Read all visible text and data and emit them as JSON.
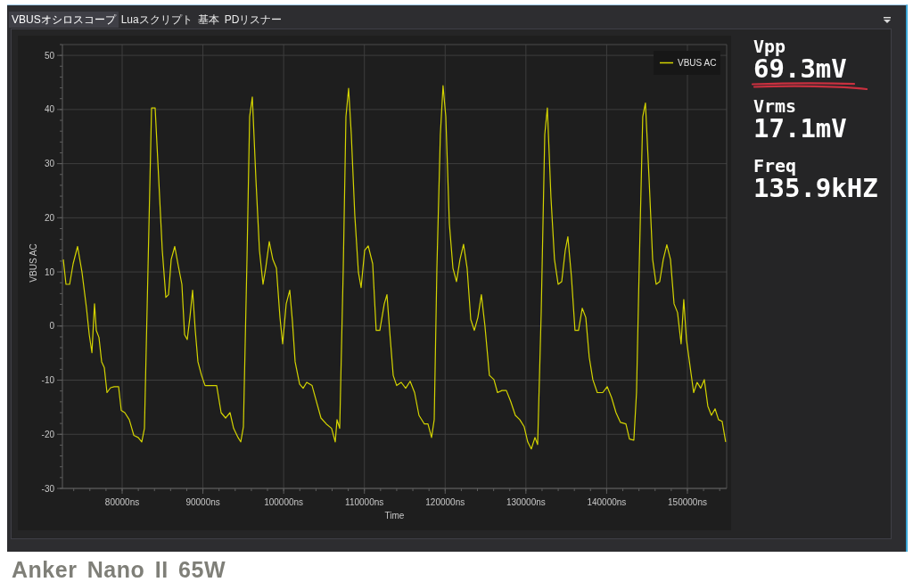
{
  "tabs": [
    {
      "label": "VBUSオシロスコープ",
      "selected": true
    },
    {
      "label": "Luaスクリプト",
      "selected": false
    },
    {
      "label": "基本",
      "selected": false
    },
    {
      "label": "PDリスナー",
      "selected": false
    }
  ],
  "chart": {
    "chart_data": {
      "type": "line",
      "xlabel": "Time",
      "ylabel": "VBUS AC",
      "grid": true,
      "x": [
        72710,
        73040,
        73490,
        73930,
        74480,
        75030,
        75580,
        75920,
        76250,
        76580,
        76800,
        77130,
        77460,
        77790,
        78120,
        78560,
        79010,
        79560,
        79890,
        80330,
        80880,
        81440,
        81990,
        82430,
        82760,
        83200,
        83640,
        84080,
        84530,
        84970,
        85410,
        85740,
        86070,
        86510,
        86960,
        87400,
        87730,
        88060,
        88390,
        88720,
        89050,
        89380,
        89830,
        90270,
        91700,
        92250,
        92810,
        93360,
        93800,
        94350,
        94680,
        95010,
        95460,
        95790,
        96120,
        96560,
        97000,
        97440,
        97770,
        98220,
        98660,
        99100,
        99540,
        99870,
        100310,
        100760,
        101090,
        101420,
        101970,
        102410,
        102850,
        103520,
        104070,
        104620,
        105280,
        105940,
        106390,
        106610,
        106940,
        107380,
        107710,
        108040,
        108370,
        108810,
        109260,
        109590,
        110030,
        110470,
        111020,
        111460,
        111910,
        112460,
        112790,
        113120,
        113560,
        114000,
        114560,
        115110,
        115660,
        116210,
        116760,
        117430,
        117870,
        118310,
        118640,
        118970,
        119410,
        119740,
        120080,
        120520,
        120960,
        121400,
        121840,
        122280,
        122720,
        123170,
        123610,
        124050,
        124490,
        124930,
        125480,
        126040,
        126480,
        127030,
        127580,
        128130,
        128690,
        129240,
        129790,
        130230,
        130670,
        131120,
        131450,
        131890,
        132330,
        132660,
        133100,
        133540,
        133990,
        134430,
        134870,
        135200,
        135640,
        136080,
        136520,
        136970,
        137410,
        137850,
        138290,
        138840,
        139510,
        140060,
        140610,
        141160,
        141710,
        142380,
        142820,
        143370,
        143700,
        144030,
        144470,
        144800,
        145250,
        145690,
        146130,
        146570,
        147010,
        147450,
        147900,
        148340,
        148780,
        149220,
        149550,
        149880,
        150320,
        150770,
        151210,
        151650,
        152090,
        152530,
        152970,
        153420,
        153860,
        154300,
        154740
      ],
      "series": [
        {
          "name": "VBUS AC",
          "color": "#d4d400",
          "values": [
            12.3,
            7.7,
            7.7,
            11.5,
            14.7,
            9.9,
            3.3,
            -1.6,
            -4.9,
            4.1,
            -0.8,
            -2.1,
            -6.6,
            -7.7,
            -12.3,
            -11.4,
            -11.2,
            -11.2,
            -15.6,
            -16.0,
            -17.3,
            -20.2,
            -20.6,
            -21.4,
            -18.9,
            10.7,
            40.3,
            40.3,
            27.2,
            14.0,
            5.3,
            5.8,
            12.3,
            14.7,
            11.0,
            7.7,
            -1.6,
            -2.5,
            1.6,
            6.6,
            -0.8,
            -6.6,
            -9.1,
            -11.0,
            -11.0,
            -16.0,
            -17.0,
            -16.0,
            -18.9,
            -20.6,
            -21.4,
            -18.6,
            12.3,
            38.7,
            42.3,
            27.2,
            14.0,
            7.7,
            10.7,
            15.6,
            12.3,
            10.7,
            1.6,
            -3.3,
            4.1,
            6.6,
            0.8,
            -6.6,
            -10.7,
            -11.5,
            -10.4,
            -11.0,
            -14.0,
            -17.0,
            -18.1,
            -18.9,
            -21.4,
            -17.3,
            -18.9,
            10.7,
            38.7,
            43.9,
            35.4,
            20.6,
            9.9,
            7.1,
            14.0,
            14.8,
            11.5,
            -0.8,
            -0.8,
            4.1,
            5.8,
            -0.8,
            -9.1,
            -11.0,
            -10.4,
            -11.5,
            -10.2,
            -12.3,
            -16.5,
            -18.1,
            -18.1,
            -20.6,
            -17.3,
            10.7,
            35.4,
            44.4,
            38.7,
            18.9,
            10.7,
            8.2,
            12.3,
            15.1,
            10.7,
            1.2,
            -0.8,
            1.6,
            5.8,
            0.0,
            -9.1,
            -9.9,
            -12.3,
            -11.9,
            -11.9,
            -14.0,
            -16.5,
            -17.3,
            -18.6,
            -21.4,
            -22.7,
            -20.6,
            -21.9,
            2.5,
            35.4,
            40.3,
            23.9,
            12.3,
            7.7,
            8.2,
            14.0,
            16.5,
            9.1,
            -0.8,
            -0.8,
            3.3,
            1.6,
            -5.8,
            -9.9,
            -12.3,
            -12.3,
            -11.2,
            -13.2,
            -16.0,
            -17.8,
            -18.1,
            -20.9,
            -21.1,
            -12.3,
            10.7,
            38.7,
            41.2,
            27.2,
            12.3,
            7.7,
            8.2,
            12.3,
            15.0,
            12.3,
            4.1,
            2.5,
            -3.3,
            4.9,
            -2.5,
            -7.4,
            -12.3,
            -10.4,
            -11.5,
            -9.9,
            -14.8,
            -16.5,
            -15.3,
            -17.3,
            -17.6,
            -21.4
          ]
        }
      ],
      "xlim": [
        72600,
        154860
      ],
      "ylim": [
        -30,
        52
      ],
      "xticks": [
        {
          "value": 80000,
          "label": "80000ns"
        },
        {
          "value": 90000,
          "label": "90000ns"
        },
        {
          "value": 100000,
          "label": "100000ns"
        },
        {
          "value": 110000,
          "label": "110000ns"
        },
        {
          "value": 120000,
          "label": "120000ns"
        },
        {
          "value": 130000,
          "label": "130000ns"
        },
        {
          "value": 140000,
          "label": "140000ns"
        },
        {
          "value": 150000,
          "label": "150000ns"
        }
      ],
      "yticks": [
        -30,
        -20,
        -10,
        0,
        10,
        20,
        30,
        40,
        50
      ]
    }
  },
  "readings": [
    {
      "label": "Vpp",
      "value": "69.3mV",
      "underlined": true
    },
    {
      "label": "Vrms",
      "value": "17.1mV",
      "underlined": false
    },
    {
      "label": "Freq",
      "value": "135.9kHZ",
      "underlined": false
    }
  ],
  "caption": "Anker Nano II 65W"
}
